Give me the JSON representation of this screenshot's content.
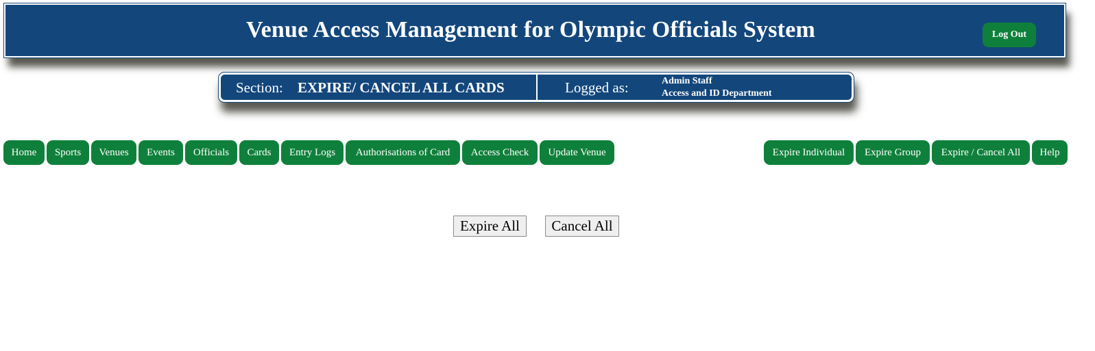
{
  "header": {
    "title": "Venue Access Management for Olympic Officials System",
    "logout_label": "Log Out"
  },
  "infobar": {
    "section_label": "Section:",
    "section_value": "EXPIRE/ CANCEL ALL CARDS",
    "logged_label": "Logged as:",
    "user_name": "Admin Staff",
    "user_department": "Access and ID Department"
  },
  "nav_left": [
    {
      "label": "Home"
    },
    {
      "label": "Sports"
    },
    {
      "label": "Venues"
    },
    {
      "label": "Events"
    },
    {
      "label": "Officials"
    },
    {
      "label": "Cards"
    },
    {
      "label": "Entry Logs"
    },
    {
      "label": "Authorisations of Card"
    },
    {
      "label": "Access Check"
    },
    {
      "label": "Update Venue"
    }
  ],
  "nav_right": [
    {
      "label": "Expire Individual"
    },
    {
      "label": "Expire Group"
    },
    {
      "label": "Expire / Cancel All"
    },
    {
      "label": "Help"
    }
  ],
  "actions": {
    "expire_all_label": "Expire All",
    "cancel_all_label": "Cancel All"
  },
  "colors": {
    "header_blue": "#13477c",
    "nav_green": "#0f803b",
    "button_gray": "#efefef"
  }
}
